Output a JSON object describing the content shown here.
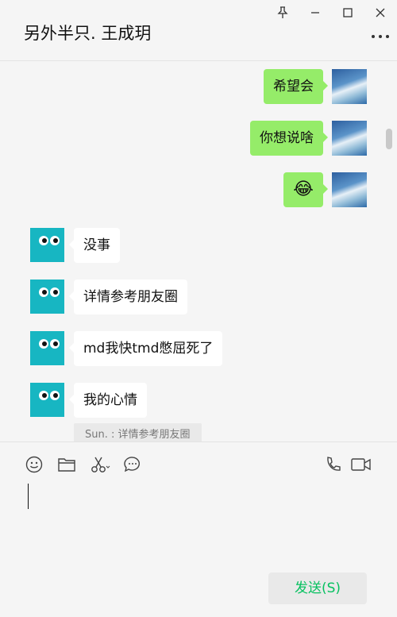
{
  "window": {
    "title": "另外半只. 王成玥",
    "controls": [
      "pin-icon",
      "minimize-icon",
      "maximize-icon",
      "close-icon"
    ]
  },
  "messages": [
    {
      "side": "me",
      "text": "希望会"
    },
    {
      "side": "me",
      "text": "你想说啥"
    },
    {
      "side": "me",
      "text": "😂"
    },
    {
      "side": "them",
      "text": "没事"
    },
    {
      "side": "them",
      "text": "详情参考朋友圈"
    },
    {
      "side": "them",
      "text": "md我快tmd憋屈死了"
    },
    {
      "side": "them",
      "text": "我的心情"
    }
  ],
  "quote": "Sun. : 详情参考朋友圈",
  "composer": {
    "tools": [
      "emoji-icon",
      "folder-icon",
      "scissors-icon",
      "chat-bubble-icon",
      "phone-icon",
      "video-call-icon"
    ],
    "send_label": "发送(S)"
  },
  "colors": {
    "my_bubble": "#95ec69",
    "their_bubble": "#ffffff",
    "bot_avatar": "#17b6c2",
    "send_text": "#07c160"
  }
}
